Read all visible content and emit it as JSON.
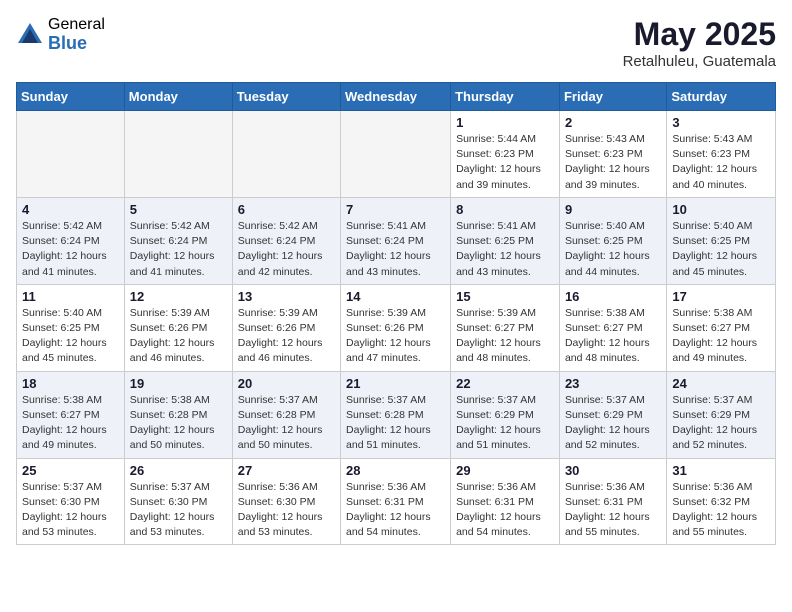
{
  "header": {
    "logo_general": "General",
    "logo_blue": "Blue",
    "month_year": "May 2025",
    "location": "Retalhuleu, Guatemala"
  },
  "weekdays": [
    "Sunday",
    "Monday",
    "Tuesday",
    "Wednesday",
    "Thursday",
    "Friday",
    "Saturday"
  ],
  "weeks": [
    [
      {
        "day": "",
        "detail": ""
      },
      {
        "day": "",
        "detail": ""
      },
      {
        "day": "",
        "detail": ""
      },
      {
        "day": "",
        "detail": ""
      },
      {
        "day": "1",
        "detail": "Sunrise: 5:44 AM\nSunset: 6:23 PM\nDaylight: 12 hours\nand 39 minutes."
      },
      {
        "day": "2",
        "detail": "Sunrise: 5:43 AM\nSunset: 6:23 PM\nDaylight: 12 hours\nand 39 minutes."
      },
      {
        "day": "3",
        "detail": "Sunrise: 5:43 AM\nSunset: 6:23 PM\nDaylight: 12 hours\nand 40 minutes."
      }
    ],
    [
      {
        "day": "4",
        "detail": "Sunrise: 5:42 AM\nSunset: 6:24 PM\nDaylight: 12 hours\nand 41 minutes."
      },
      {
        "day": "5",
        "detail": "Sunrise: 5:42 AM\nSunset: 6:24 PM\nDaylight: 12 hours\nand 41 minutes."
      },
      {
        "day": "6",
        "detail": "Sunrise: 5:42 AM\nSunset: 6:24 PM\nDaylight: 12 hours\nand 42 minutes."
      },
      {
        "day": "7",
        "detail": "Sunrise: 5:41 AM\nSunset: 6:24 PM\nDaylight: 12 hours\nand 43 minutes."
      },
      {
        "day": "8",
        "detail": "Sunrise: 5:41 AM\nSunset: 6:25 PM\nDaylight: 12 hours\nand 43 minutes."
      },
      {
        "day": "9",
        "detail": "Sunrise: 5:40 AM\nSunset: 6:25 PM\nDaylight: 12 hours\nand 44 minutes."
      },
      {
        "day": "10",
        "detail": "Sunrise: 5:40 AM\nSunset: 6:25 PM\nDaylight: 12 hours\nand 45 minutes."
      }
    ],
    [
      {
        "day": "11",
        "detail": "Sunrise: 5:40 AM\nSunset: 6:25 PM\nDaylight: 12 hours\nand 45 minutes."
      },
      {
        "day": "12",
        "detail": "Sunrise: 5:39 AM\nSunset: 6:26 PM\nDaylight: 12 hours\nand 46 minutes."
      },
      {
        "day": "13",
        "detail": "Sunrise: 5:39 AM\nSunset: 6:26 PM\nDaylight: 12 hours\nand 46 minutes."
      },
      {
        "day": "14",
        "detail": "Sunrise: 5:39 AM\nSunset: 6:26 PM\nDaylight: 12 hours\nand 47 minutes."
      },
      {
        "day": "15",
        "detail": "Sunrise: 5:39 AM\nSunset: 6:27 PM\nDaylight: 12 hours\nand 48 minutes."
      },
      {
        "day": "16",
        "detail": "Sunrise: 5:38 AM\nSunset: 6:27 PM\nDaylight: 12 hours\nand 48 minutes."
      },
      {
        "day": "17",
        "detail": "Sunrise: 5:38 AM\nSunset: 6:27 PM\nDaylight: 12 hours\nand 49 minutes."
      }
    ],
    [
      {
        "day": "18",
        "detail": "Sunrise: 5:38 AM\nSunset: 6:27 PM\nDaylight: 12 hours\nand 49 minutes."
      },
      {
        "day": "19",
        "detail": "Sunrise: 5:38 AM\nSunset: 6:28 PM\nDaylight: 12 hours\nand 50 minutes."
      },
      {
        "day": "20",
        "detail": "Sunrise: 5:37 AM\nSunset: 6:28 PM\nDaylight: 12 hours\nand 50 minutes."
      },
      {
        "day": "21",
        "detail": "Sunrise: 5:37 AM\nSunset: 6:28 PM\nDaylight: 12 hours\nand 51 minutes."
      },
      {
        "day": "22",
        "detail": "Sunrise: 5:37 AM\nSunset: 6:29 PM\nDaylight: 12 hours\nand 51 minutes."
      },
      {
        "day": "23",
        "detail": "Sunrise: 5:37 AM\nSunset: 6:29 PM\nDaylight: 12 hours\nand 52 minutes."
      },
      {
        "day": "24",
        "detail": "Sunrise: 5:37 AM\nSunset: 6:29 PM\nDaylight: 12 hours\nand 52 minutes."
      }
    ],
    [
      {
        "day": "25",
        "detail": "Sunrise: 5:37 AM\nSunset: 6:30 PM\nDaylight: 12 hours\nand 53 minutes."
      },
      {
        "day": "26",
        "detail": "Sunrise: 5:37 AM\nSunset: 6:30 PM\nDaylight: 12 hours\nand 53 minutes."
      },
      {
        "day": "27",
        "detail": "Sunrise: 5:36 AM\nSunset: 6:30 PM\nDaylight: 12 hours\nand 53 minutes."
      },
      {
        "day": "28",
        "detail": "Sunrise: 5:36 AM\nSunset: 6:31 PM\nDaylight: 12 hours\nand 54 minutes."
      },
      {
        "day": "29",
        "detail": "Sunrise: 5:36 AM\nSunset: 6:31 PM\nDaylight: 12 hours\nand 54 minutes."
      },
      {
        "day": "30",
        "detail": "Sunrise: 5:36 AM\nSunset: 6:31 PM\nDaylight: 12 hours\nand 55 minutes."
      },
      {
        "day": "31",
        "detail": "Sunrise: 5:36 AM\nSunset: 6:32 PM\nDaylight: 12 hours\nand 55 minutes."
      }
    ]
  ]
}
